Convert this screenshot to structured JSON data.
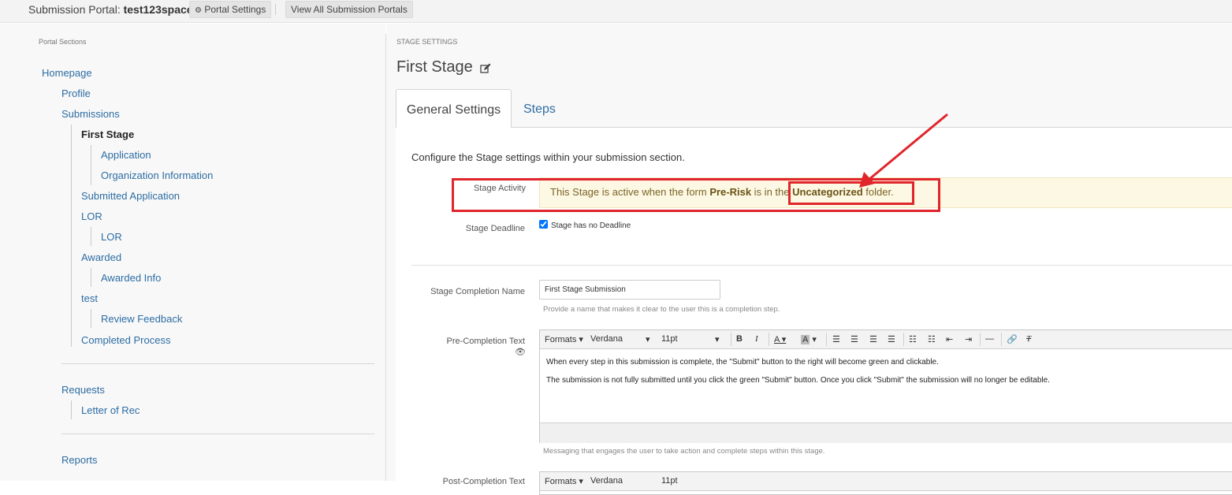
{
  "topbar": {
    "portal_label": "Submission Portal:",
    "portal_name": "test123space",
    "portal_settings_label": "Portal Settings",
    "view_all_label": "View All Submission Portals"
  },
  "sidebar": {
    "section_label": "Portal Sections",
    "items": [
      {
        "label": "Homepage"
      },
      {
        "label": "Profile"
      },
      {
        "label": "Submissions"
      },
      {
        "label": "First Stage"
      },
      {
        "label": "Application"
      },
      {
        "label": "Organization Information"
      },
      {
        "label": "Submitted Application"
      },
      {
        "label": "LOR"
      },
      {
        "label": "LOR"
      },
      {
        "label": "Awarded"
      },
      {
        "label": "Awarded Info"
      },
      {
        "label": "test"
      },
      {
        "label": "Review Feedback"
      },
      {
        "label": "Completed Process"
      },
      {
        "label": "Requests"
      },
      {
        "label": "Letter of Rec"
      },
      {
        "label": "Reports"
      }
    ]
  },
  "main": {
    "section_label": "STAGE SETTINGS",
    "title": "First Stage",
    "tabs": [
      {
        "label": "General Settings"
      },
      {
        "label": "Steps"
      }
    ],
    "intro": "Configure the Stage settings within your submission section.",
    "stage_activity": {
      "label": "Stage Activity",
      "text_before": "This Stage is active when the form ",
      "form_name": "Pre-Risk",
      "text_middle": " is in the ",
      "folder_name": "Uncategorized",
      "text_after": " folder."
    },
    "stage_deadline": {
      "label": "Stage Deadline",
      "checkbox_label": "Stage has no Deadline",
      "checked": true
    },
    "completion_name": {
      "label": "Stage Completion Name",
      "value": "First Stage Submission",
      "help": "Provide a name that makes it clear to the user this is a completion step."
    },
    "pre_completion": {
      "label": "Pre-Completion Text",
      "paragraphs": [
        "When every step in this submission is complete, the \"Submit\" button to the right will become green and clickable.",
        "The submission is not fully submitted until you click the green \"Submit\" button. Once you click \"Submit\" the submission will no longer be editable."
      ],
      "help": "Messaging that engages the user to take action and complete steps within this stage."
    },
    "post_completion": {
      "label": "Post-Completion Text"
    },
    "toolbar": {
      "formats": "Formats",
      "font": "Verdana",
      "size": "11pt",
      "bold": "B",
      "italic": "I",
      "text_color": "A",
      "bg_color": "A"
    }
  },
  "colors": {
    "link": "#2d6da3",
    "annotation_red": "#e0252b",
    "alert_bg": "#fcf8e3",
    "alert_text": "#7c6428"
  }
}
